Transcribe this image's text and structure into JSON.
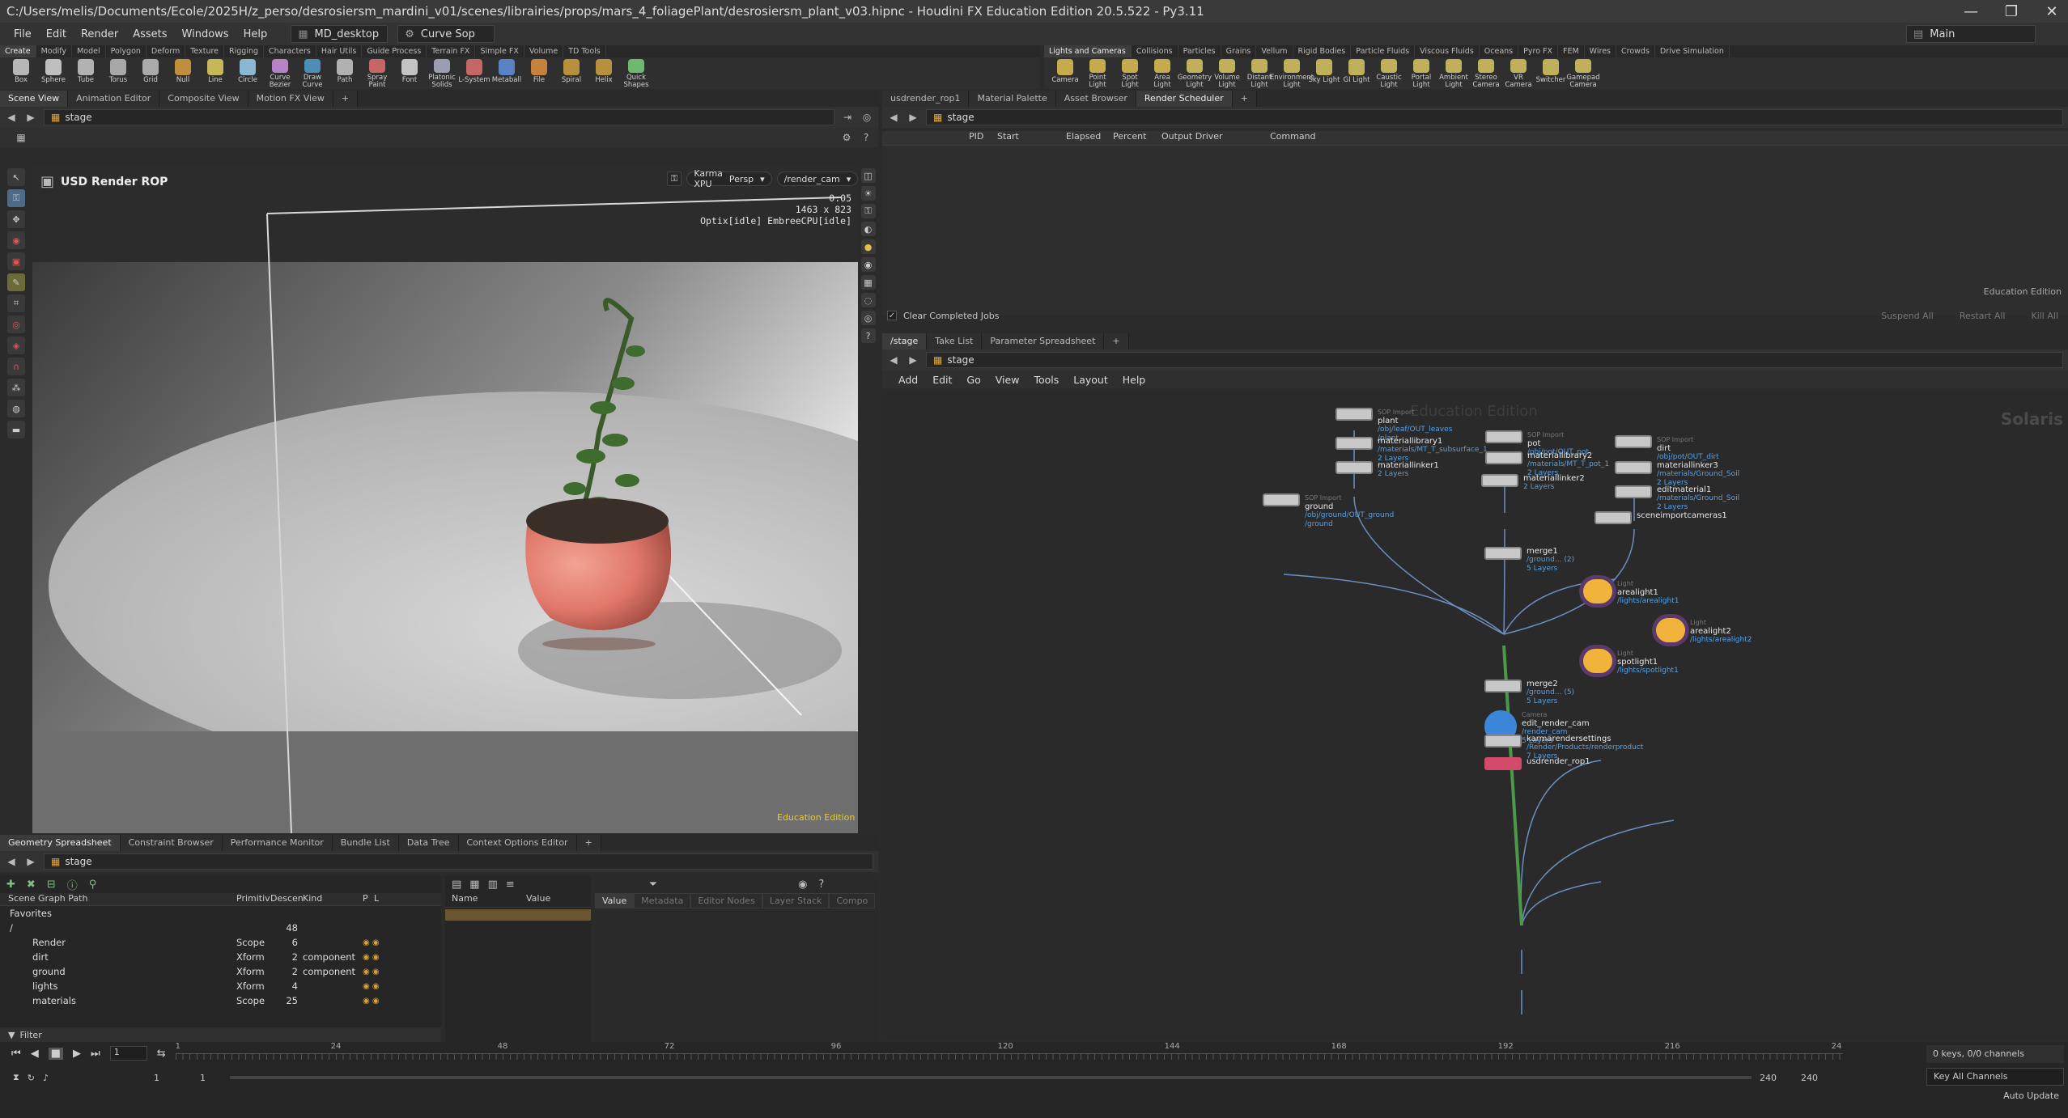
{
  "window": {
    "title": "C:/Users/melis/Documents/Ecole/2025H/z_perso/desrosiersm_mardini_v01/scenes/librairies/props/mars_4_foliagePlant/desrosiersm_plant_v03.hipnc - Houdini FX Education Edition 20.5.522 - Py3.11",
    "controls": [
      "—",
      "❐",
      "✕"
    ]
  },
  "menubar": {
    "items": [
      "File",
      "Edit",
      "Render",
      "Assets",
      "Windows",
      "Help"
    ],
    "desktop": "MD_desktop",
    "context": "Curve Sop",
    "right_desktop": "Main"
  },
  "shelf_left": {
    "tabs": [
      "Create",
      "Modify",
      "Model",
      "Polygon",
      "Deform",
      "Texture",
      "Rigging",
      "Characters",
      "Hair Utils",
      "Guide Process",
      "Terrain FX",
      "Simple FX",
      "Volume",
      "TD Tools"
    ],
    "tools": [
      "Box",
      "Sphere",
      "Tube",
      "Torus",
      "Grid",
      "Null",
      "Line",
      "Circle",
      "Curve Bezier",
      "Draw Curve",
      "Path",
      "Spray Paint",
      "Font",
      "Platonic Solids",
      "L-System",
      "Metaball",
      "File",
      "Spiral",
      "Helix",
      "Quick Shapes"
    ]
  },
  "shelf_right": {
    "tabs": [
      "Lights and Cameras",
      "Collisions",
      "Particles",
      "Grains",
      "Vellum",
      "Rigid Bodies",
      "Particle Fluids",
      "Viscous Fluids",
      "Oceans",
      "Pyro FX",
      "FEM",
      "Wires",
      "Crowds",
      "Drive Simulation"
    ],
    "tools": [
      "Camera",
      "Point Light",
      "Spot Light",
      "Area Light",
      "Geometry Light",
      "Volume Light",
      "Distant Light",
      "Environment Light",
      "Sky Light",
      "GI Light",
      "Caustic Light",
      "Portal Light",
      "Ambient Light",
      "Stereo Camera",
      "VR Camera",
      "Switcher",
      "Gamepad Camera"
    ]
  },
  "viewport_pane": {
    "tabs": [
      "Scene View",
      "Animation Editor",
      "Composite View",
      "Motion FX View"
    ],
    "path": "stage",
    "header": "USD Render ROP",
    "renderer": "Karma XPU",
    "view": "Persp",
    "camera": "/render_cam",
    "stats": [
      "0:05",
      "1463 x 823",
      "Optix[idle] EmbreeCPU[idle]"
    ],
    "watermark": "Education Edition"
  },
  "spreadsheet_pane": {
    "tabs": [
      "Geometry Spreadsheet",
      "Constraint Browser",
      "Performance Monitor",
      "Bundle List",
      "Data Tree",
      "Context Options Editor"
    ],
    "path": "stage",
    "columns": [
      "Scene Graph Path",
      "Primitiv",
      "Descen",
      "Kind",
      "P",
      "L"
    ],
    "rows": [
      {
        "name": "Favorites",
        "type": "",
        "desc": "",
        "kind": ""
      },
      {
        "name": "/",
        "type": "",
        "desc": "48",
        "kind": ""
      },
      {
        "name": "Render",
        "type": "Scope",
        "desc": "6",
        "kind": ""
      },
      {
        "name": "dirt",
        "type": "Xform",
        "desc": "2",
        "kind": "component"
      },
      {
        "name": "ground",
        "type": "Xform",
        "desc": "2",
        "kind": "component"
      },
      {
        "name": "lights",
        "type": "Xform",
        "desc": "4",
        "kind": ""
      },
      {
        "name": "materials",
        "type": "Scope",
        "desc": "25",
        "kind": ""
      }
    ],
    "filter_label": "Filter",
    "attr_columns": [
      "Name",
      "Value"
    ],
    "inspector_tabs": [
      "Value",
      "Metadata",
      "Editor Nodes",
      "Layer Stack",
      "Compo"
    ],
    "edu_text": "Education"
  },
  "scheduler_pane": {
    "tabs": [
      "usdrender_rop1",
      "Material Palette",
      "Asset Browser",
      "Render Scheduler"
    ],
    "path": "stage",
    "columns": [
      "PID",
      "Start",
      "Elapsed",
      "Percent",
      "Output Driver",
      "Command"
    ],
    "clear_label": "Clear Completed Jobs",
    "buttons": [
      "Suspend All",
      "Restart All",
      "Kill All"
    ],
    "edu_text": "Education Edition"
  },
  "network_pane": {
    "tabs": [
      "/stage",
      "Take List",
      "Parameter Spreadsheet"
    ],
    "path": "stage",
    "menus": [
      "Add",
      "Edit",
      "Go",
      "View",
      "Tools",
      "Layout",
      "Help"
    ],
    "watermark": "Education Edition",
    "context_label": "Solaris",
    "nodes": [
      {
        "name": "plant",
        "tag": "SOP Import",
        "sub": [
          "/obj/leaf/OUT_leaves",
          "/plant"
        ],
        "color": "#c8c8c8"
      },
      {
        "name": "materiallibrary1",
        "tag": "",
        "sub": [
          "/materials/MT_T_subsurface_1",
          "2 Layers"
        ],
        "color": "#c8c8c8"
      },
      {
        "name": "materiallinker1",
        "tag": "",
        "sub": [
          "2 Layers"
        ],
        "color": "#c8c8c8"
      },
      {
        "name": "pot",
        "tag": "SOP Import",
        "sub": [
          "/obj/pot/OUT_pot"
        ],
        "color": "#c8c8c8"
      },
      {
        "name": "materiallibrary2",
        "tag": "",
        "sub": [
          "/materials/MT_T_pot_1",
          "2 Layers"
        ],
        "color": "#c8c8c8"
      },
      {
        "name": "materiallinker2",
        "tag": "",
        "sub": [
          "2 Layers"
        ],
        "color": "#c8c8c8"
      },
      {
        "name": "dirt",
        "tag": "SOP Import",
        "sub": [
          "/obj/pot/OUT_dirt"
        ],
        "color": "#c8c8c8"
      },
      {
        "name": "materiallinker3",
        "tag": "",
        "sub": [
          "/materials/Ground_Soil",
          "2 Layers"
        ],
        "color": "#c8c8c8"
      },
      {
        "name": "editmaterial1",
        "tag": "",
        "sub": [
          "/materials/Ground_Soil",
          "2 Layers"
        ],
        "color": "#c8c8c8"
      },
      {
        "name": "sceneimportcameras1",
        "tag": "",
        "sub": [],
        "color": "#c8c8c8"
      },
      {
        "name": "ground",
        "tag": "SOP Import",
        "sub": [
          "/obj/ground/OUT_ground",
          "/ground"
        ],
        "color": "#c8c8c8"
      },
      {
        "name": "merge1",
        "tag": "",
        "sub": [
          "/ground... (2)",
          "5 Layers"
        ],
        "color": "#c8c8c8"
      },
      {
        "name": "arealight1",
        "tag": "Light",
        "sub": [
          "/lights/arealight1"
        ],
        "color": "#f2b33d"
      },
      {
        "name": "arealight2",
        "tag": "Light",
        "sub": [
          "/lights/arealight2"
        ],
        "color": "#f2b33d"
      },
      {
        "name": "spotlight1",
        "tag": "Light",
        "sub": [
          "/lights/spotlight1"
        ],
        "color": "#f2b33d"
      },
      {
        "name": "merge2",
        "tag": "",
        "sub": [
          "/ground... (5)",
          "5 Layers"
        ],
        "color": "#c8c8c8"
      },
      {
        "name": "edit_render_cam",
        "tag": "Camera",
        "sub": [
          "/render_cam",
          "5 Layers"
        ],
        "color": "#3c86d9"
      },
      {
        "name": "karmarendersettings",
        "tag": "",
        "sub": [
          "/Render/Products/renderproduct",
          "7 Layers"
        ],
        "color": "#c8c8c8"
      },
      {
        "name": "usdrender_rop1",
        "tag": "",
        "sub": [],
        "color": "#d44a6a"
      }
    ]
  },
  "timeline": {
    "frame": "1",
    "ticks": [
      "1",
      "24",
      "48",
      "72",
      "96",
      "120",
      "144",
      "168",
      "192",
      "216",
      "24"
    ],
    "range_start": "1",
    "range_start2": "1",
    "range_end": "240",
    "range_end2": "240",
    "keys_label": "0 keys, 0/0 channels",
    "key_all": "Key All Channels",
    "auto_update": "Auto Update"
  }
}
